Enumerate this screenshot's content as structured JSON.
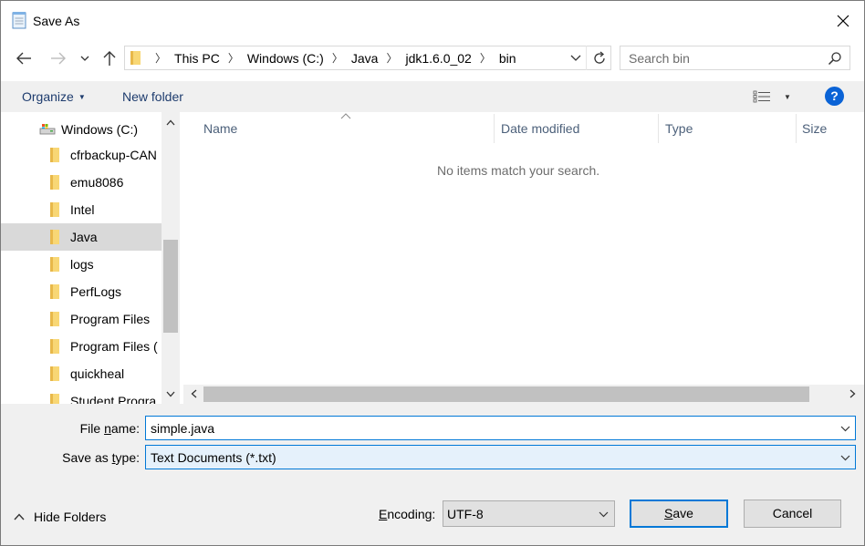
{
  "window": {
    "title": "Save As",
    "close_glyph": "✕"
  },
  "address": {
    "crumbs": [
      "This PC",
      "Windows (C:)",
      "Java",
      "jdk1.6.0_02",
      "bin"
    ],
    "search_placeholder": "Search bin"
  },
  "commands": {
    "organize": "Organize",
    "new_folder": "New folder",
    "help": "?"
  },
  "nav_tree": {
    "drive": "Windows (C:)",
    "folders": [
      "cfrbackup-CAN",
      "emu8086",
      "Intel",
      "Java",
      "logs",
      "PerfLogs",
      "Program Files",
      "Program Files (",
      "quickheal",
      "Student Progra"
    ],
    "selected": "Java"
  },
  "file_list": {
    "columns": [
      "Name",
      "Date modified",
      "Type",
      "Size"
    ],
    "empty_message": "No items match your search."
  },
  "form": {
    "file_name_label_pre": "File ",
    "file_name_label_u": "n",
    "file_name_label_post": "ame:",
    "file_name_value": "simple.java",
    "type_label_pre": "Save as ",
    "type_label_u": "t",
    "type_label_post": "ype:",
    "type_value": "Text Documents (*.txt)",
    "encoding_label_pre": "",
    "encoding_label_u": "E",
    "encoding_label_post": "ncoding:",
    "encoding_value": "UTF-8"
  },
  "footer": {
    "hide_folders": "Hide Folders",
    "save_u": "S",
    "save_post": "ave",
    "cancel": "Cancel"
  },
  "colors": {
    "accent": "#0078d7",
    "folder": "#f8d775",
    "help": "#0a63d6"
  }
}
